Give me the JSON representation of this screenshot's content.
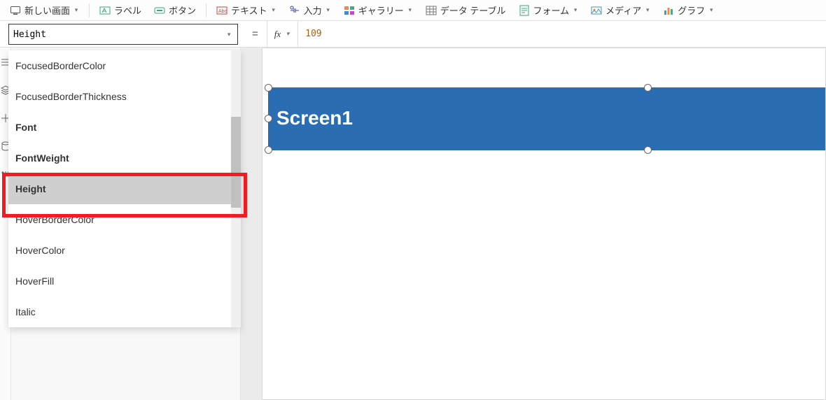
{
  "toolbar": {
    "new_screen": "新しい画面",
    "label": "ラベル",
    "button": "ボタン",
    "text": "テキスト",
    "input": "入力",
    "gallery": "ギャラリー",
    "datatable": "データ テーブル",
    "form": "フォーム",
    "media": "メディア",
    "chart": "グラフ"
  },
  "formula": {
    "property": "Height",
    "eq": "=",
    "fx": "fx",
    "value": "109"
  },
  "dropdown": {
    "items": [
      {
        "label": "FocusedBorderColor",
        "bold": false,
        "selected": false
      },
      {
        "label": "FocusedBorderThickness",
        "bold": false,
        "selected": false
      },
      {
        "label": "Font",
        "bold": true,
        "selected": false
      },
      {
        "label": "FontWeight",
        "bold": true,
        "selected": false
      },
      {
        "label": "Height",
        "bold": true,
        "selected": true
      },
      {
        "label": "HoverBorderColor",
        "bold": false,
        "selected": false
      },
      {
        "label": "HoverColor",
        "bold": false,
        "selected": false
      },
      {
        "label": "HoverFill",
        "bold": false,
        "selected": false
      },
      {
        "label": "Italic",
        "bold": false,
        "selected": false
      }
    ]
  },
  "canvas": {
    "title": "Screen1"
  }
}
